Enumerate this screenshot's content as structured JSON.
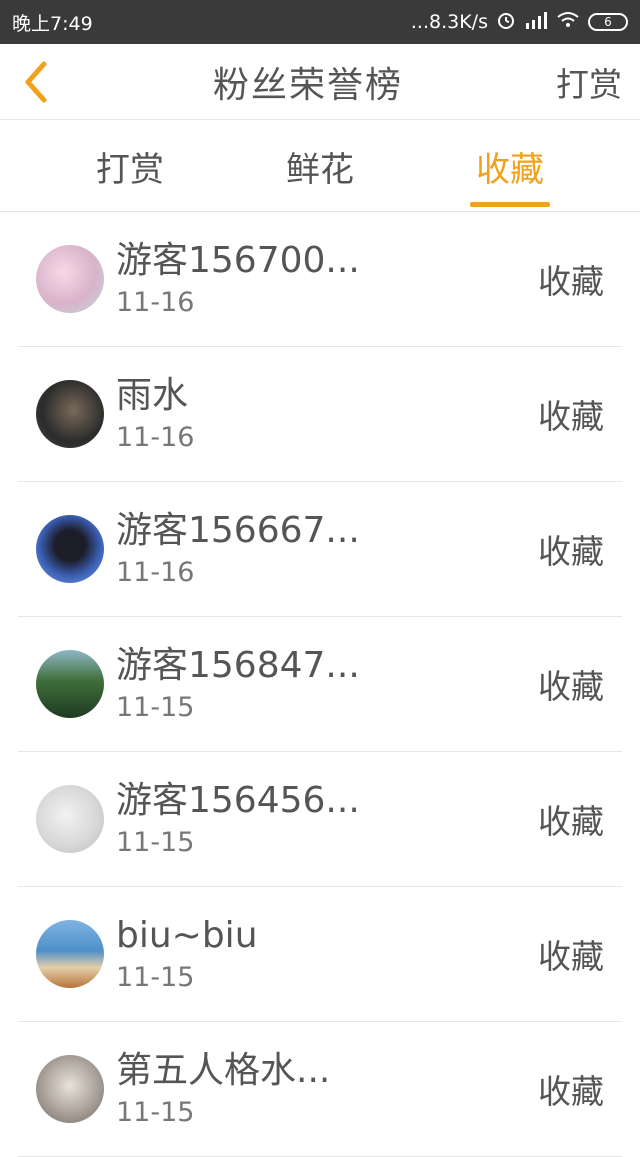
{
  "status_bar": {
    "time": "晚上7:49",
    "network": "...8.3K/s",
    "battery": "6"
  },
  "header": {
    "title": "粉丝荣誉榜",
    "right_label": "打赏"
  },
  "tabs": [
    {
      "label": "打赏"
    },
    {
      "label": "鲜花"
    },
    {
      "label": "收藏"
    }
  ],
  "active_tab": "收藏",
  "list": [
    {
      "name": "游客156700...",
      "date": "11-16",
      "action": "收藏"
    },
    {
      "name": "雨水",
      "date": "11-16",
      "action": "收藏"
    },
    {
      "name": "游客156667...",
      "date": "11-16",
      "action": "收藏"
    },
    {
      "name": "游客156847...",
      "date": "11-15",
      "action": "收藏"
    },
    {
      "name": "游客156456...",
      "date": "11-15",
      "action": "收藏"
    },
    {
      "name": "biu~biu",
      "date": "11-15",
      "action": "收藏"
    },
    {
      "name": "第五人格水...",
      "date": "11-15",
      "action": "收藏"
    }
  ],
  "colors": {
    "accent": "#f0a21b",
    "text": "#555555",
    "status_bg": "#3a3a3a"
  }
}
